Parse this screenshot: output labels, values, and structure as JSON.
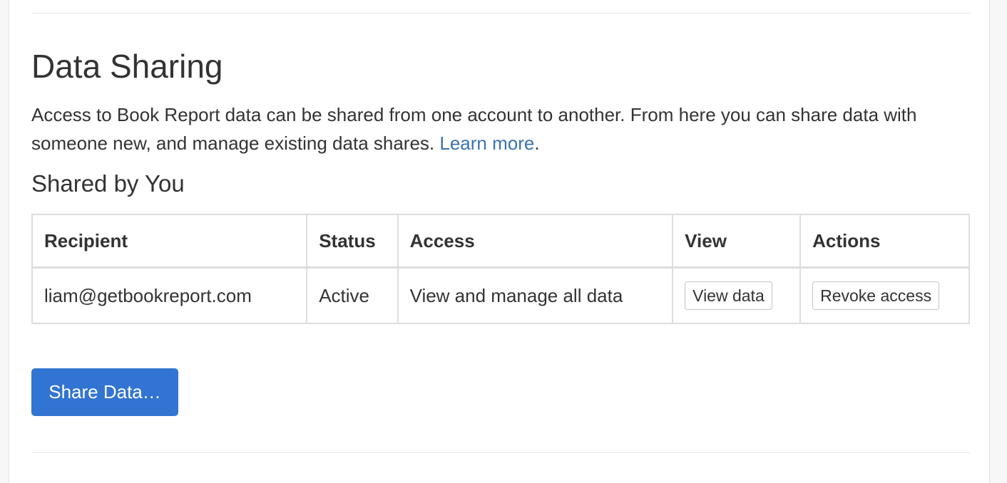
{
  "section": {
    "title": "Data Sharing",
    "description_text": "Access to Book Report data can be shared from one account to another. From here you can share data with someone new, and manage existing data shares. ",
    "learn_more_label": "Learn more",
    "description_end": "."
  },
  "shared_by_you": {
    "title": "Shared by You",
    "columns": {
      "recipient": "Recipient",
      "status": "Status",
      "access": "Access",
      "view": "View",
      "actions": "Actions"
    },
    "rows": [
      {
        "recipient": "liam@getbookreport.com",
        "status": "Active",
        "access": "View and manage all data",
        "view_label": "View data",
        "action_label": "Revoke access"
      }
    ]
  },
  "share_button_label": "Share Data…",
  "colors": {
    "link": "#3a72b2",
    "primary_button": "#3274d1"
  }
}
